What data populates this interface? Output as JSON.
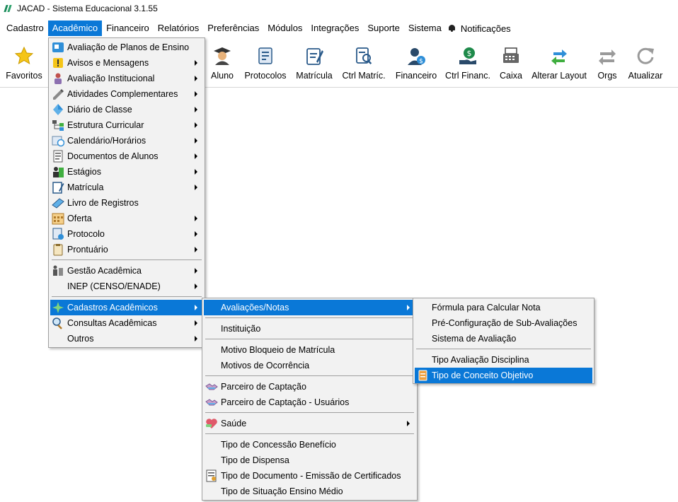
{
  "title": "JACAD - Sistema Educacional 3.1.55",
  "menubar": {
    "items": [
      "Cadastro",
      "Acadêmico",
      "Financeiro",
      "Relatórios",
      "Preferências",
      "Módulos",
      "Integrações",
      "Suporte",
      "Sistema"
    ],
    "active": "Acadêmico",
    "notifications": "Notificações"
  },
  "toolbar": {
    "buttons": [
      {
        "label": "Favoritos",
        "icon": "star-icon"
      },
      {
        "label": "Aluno",
        "icon": "graduate-icon"
      },
      {
        "label": "Protocolos",
        "icon": "protocol-icon"
      },
      {
        "label": "Matrícula",
        "icon": "enrollment-icon"
      },
      {
        "label": "Ctrl Matríc.",
        "icon": "enrollment-search-icon"
      },
      {
        "label": "Financeiro",
        "icon": "finance-user-icon"
      },
      {
        "label": "Ctrl Financ.",
        "icon": "money-hand-icon"
      },
      {
        "label": "Caixa",
        "icon": "cash-register-icon"
      },
      {
        "label": "Alterar Layout",
        "icon": "swap-arrows-icon"
      },
      {
        "label": "Orgs",
        "icon": "horizontal-arrows-icon"
      },
      {
        "label": "Atualizar",
        "icon": "refresh-icon"
      }
    ]
  },
  "academico_menu": {
    "items": [
      "Avaliação de Planos de Ensino",
      "Avisos e Mensagens",
      "Avaliação Institucional",
      "Atividades Complementares",
      "Diário de Classe",
      "Estrutura Curricular",
      "Calendário/Horários",
      "Documentos de Alunos",
      "Estágios",
      "Matrícula",
      "Livro de Registros",
      "Oferta",
      "Protocolo",
      "Prontuário",
      "Gestão Acadêmica",
      "INEP (CENSO/ENADE)",
      "Cadastros Acadêmicos",
      "Consultas Acadêmicas",
      "Outros"
    ]
  },
  "cadastros_menu": {
    "items": [
      "Avaliações/Notas",
      "Instituição",
      "Motivo Bloqueio de Matrícula",
      "Motivos de Ocorrência",
      "Parceiro de Captação",
      "Parceiro de Captação - Usuários",
      "Saúde",
      "Tipo de Concessão Benefício",
      "Tipo de Dispensa",
      "Tipo de Documento - Emissão de Certificados",
      "Tipo de Situação Ensino Médio"
    ]
  },
  "avaliacoes_menu": {
    "items": [
      "Fórmula para Calcular Nota",
      "Pré-Configuração de Sub-Avaliações",
      "Sistema de Avaliação",
      "Tipo Avaliação Disciplina",
      "Tipo de Conceito Objetivo"
    ]
  },
  "colors": {
    "highlight": "#0a78d7",
    "menu_bg": "#f2f2f2"
  }
}
